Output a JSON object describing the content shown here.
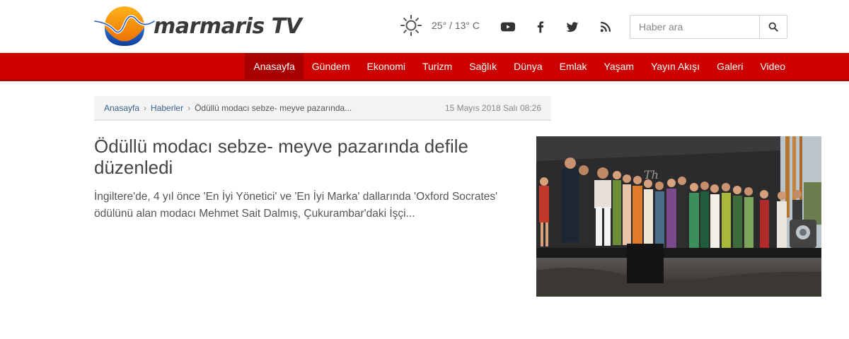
{
  "header": {
    "logo_text": "marmaris TV",
    "weather": {
      "icon": "sun-icon",
      "text": "25° / 13° C"
    },
    "social": [
      {
        "name": "youtube",
        "icon": "youtube-icon"
      },
      {
        "name": "facebook",
        "icon": "facebook-icon"
      },
      {
        "name": "twitter",
        "icon": "twitter-icon"
      },
      {
        "name": "rss",
        "icon": "rss-icon"
      }
    ],
    "search": {
      "placeholder": "Haber ara",
      "value": "",
      "icon": "search-icon"
    }
  },
  "nav": {
    "items": [
      "Anasayfa",
      "Gündem",
      "Ekonomi",
      "Turizm",
      "Sağlık",
      "Dünya",
      "Emlak",
      "Yaşam",
      "Yayın Akışı",
      "Galeri",
      "Video"
    ],
    "active_index": 0
  },
  "breadcrumb": {
    "home": "Anasayfa",
    "section": "Haberler",
    "current": "Ödüllü modacı sebze- meyve pazarında...",
    "date": "15 Mayıs 2018 Salı 08:26"
  },
  "article": {
    "title": "Ödüllü modacı sebze- meyve pazarında defile düzenledi",
    "summary": "İngiltere'de, 4 yıl önce 'En İyi Yönetici' ve 'En İyi Marka' dallarında 'Oxford Socrates' ödülünü alan modacı Mehmet Sait Dalmış, Çukurambar'daki İşçi..."
  },
  "colors": {
    "nav_bg": "#cc0000",
    "nav_active": "#a80000",
    "logo_orange": "#f39200",
    "logo_blue": "#1f56b4",
    "breadcrumb_link": "#3a5f8a"
  }
}
